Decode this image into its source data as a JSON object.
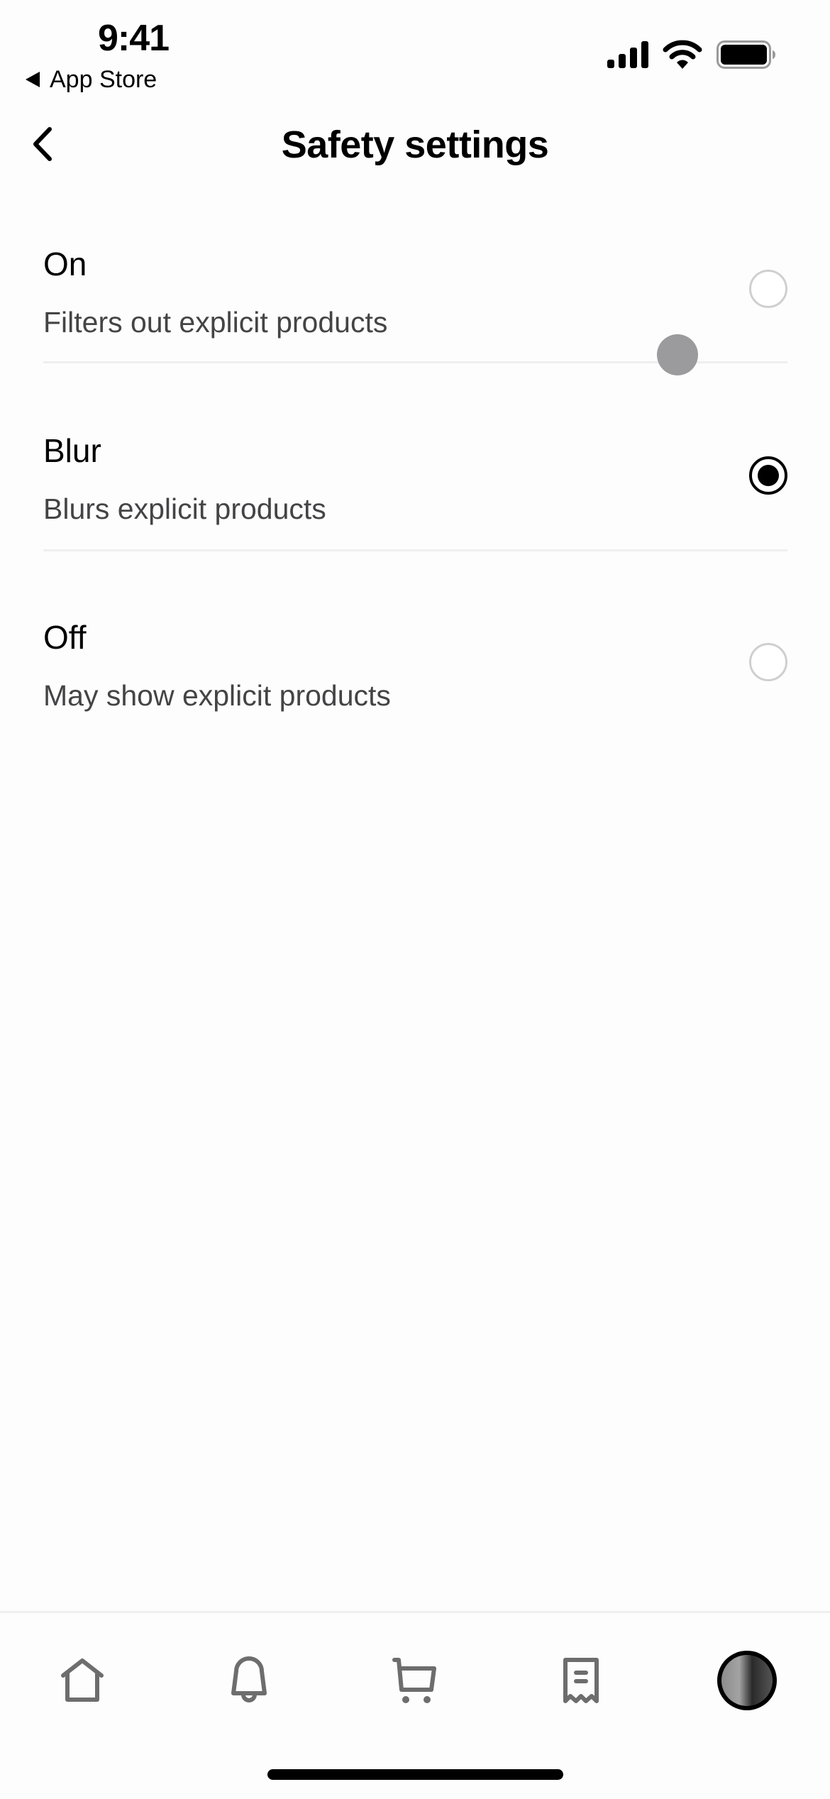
{
  "status_bar": {
    "time": "9:41",
    "back_app_label": "App Store",
    "icons": [
      "cellular-signal-icon",
      "wifi-icon",
      "battery-icon"
    ]
  },
  "nav": {
    "back_icon": "chevron-left-icon",
    "title": "Safety settings"
  },
  "options": [
    {
      "title": "On",
      "subtitle": "Filters out explicit products",
      "selected": false
    },
    {
      "title": "Blur",
      "subtitle": "Blurs explicit products",
      "selected": true
    },
    {
      "title": "Off",
      "subtitle": "May show explicit products",
      "selected": false
    }
  ],
  "tab_bar": {
    "items": [
      {
        "name": "home",
        "icon": "home-icon"
      },
      {
        "name": "notifications",
        "icon": "bell-icon"
      },
      {
        "name": "cart",
        "icon": "cart-icon"
      },
      {
        "name": "orders",
        "icon": "receipt-icon"
      },
      {
        "name": "profile",
        "icon": "avatar"
      }
    ]
  },
  "colors": {
    "text_primary": "#000000",
    "text_secondary": "#444446",
    "icon_gray": "#6d6d6d",
    "divider": "#efefef",
    "radio_unselected": "#cfcfcf",
    "radio_selected": "#000000"
  }
}
